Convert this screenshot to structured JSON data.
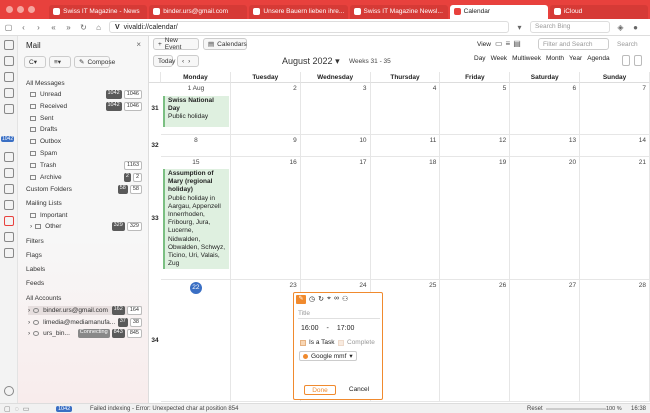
{
  "browser": {
    "tabs": [
      {
        "label": "Swiss IT Magazine - News"
      },
      {
        "label": "binder.urs@gmail.com"
      },
      {
        "label": "Unsere Bauern lieben ihre..."
      },
      {
        "label": "Swiss IT Magazine Newsl..."
      },
      {
        "label": "Calendar"
      },
      {
        "label": "iCloud"
      }
    ],
    "url": "vivaldi://calendar/",
    "search_placeholder": "Search Bing"
  },
  "mail": {
    "title": "Mail",
    "refresh": "C",
    "compose": "Compose",
    "all_messages": "All Messages",
    "folders": [
      {
        "label": "Unread",
        "c1": "1042",
        "c2": "1046"
      },
      {
        "label": "Received",
        "c1": "1042",
        "c2": "1046"
      },
      {
        "label": "Sent",
        "c1": "",
        "c2": ""
      },
      {
        "label": "Drafts",
        "c1": "",
        "c2": ""
      },
      {
        "label": "Outbox",
        "c1": "",
        "c2": ""
      },
      {
        "label": "Spam",
        "c1": "",
        "c2": ""
      },
      {
        "label": "Trash",
        "c1": "",
        "c2": "1163"
      },
      {
        "label": "Archive",
        "c1": "2",
        "c2": "2"
      }
    ],
    "custom_folders": "Custom Folders",
    "custom_counts": [
      "58",
      "58"
    ],
    "mailing_lists": "Mailing Lists",
    "important": "Important",
    "other": "Other",
    "other_counts": [
      "329",
      "329"
    ],
    "filters": "Filters",
    "flags": "Flags",
    "labels": "Labels",
    "feeds": "Feeds",
    "all_accounts": "All Accounts",
    "accounts": [
      {
        "label": "binder.urs@gmail.com",
        "c1": "162",
        "c2": "164"
      },
      {
        "label": "limedia@mediamanufa...",
        "c1": "37",
        "c2": "38"
      },
      {
        "label": "urs_bin...",
        "c1": "Connecting",
        "c2": "843",
        "c3": "845"
      }
    ],
    "badge": "1042"
  },
  "calendar": {
    "new_event": "New Event",
    "calendars": "Calendars",
    "view_label": "View",
    "filter_placeholder": "Filter and Search",
    "search_btn": "Search",
    "today": "Today",
    "month_title": "August 2022",
    "weeks": "Weeks 31 - 35",
    "views": [
      "Day",
      "Week",
      "Multiweek",
      "Month",
      "Year",
      "Agenda"
    ],
    "days": [
      "Monday",
      "Tuesday",
      "Wednesday",
      "Thursday",
      "Friday",
      "Saturday",
      "Sunday"
    ],
    "weeknums": [
      "31",
      "32",
      "33",
      "34"
    ],
    "rows": [
      [
        "1 Aug",
        "2",
        "3",
        "4",
        "5",
        "6",
        "7"
      ],
      [
        "8",
        "9",
        "10",
        "11",
        "12",
        "13",
        "14"
      ],
      [
        "15",
        "16",
        "17",
        "18",
        "19",
        "20",
        "21"
      ],
      [
        "22",
        "23",
        "24",
        "25",
        "26",
        "27",
        "28"
      ]
    ],
    "events": [
      {
        "title": "Swiss National Day",
        "sub": "Public holiday"
      },
      {
        "title": "Assumption of Mary (regional holiday)",
        "sub": "Public holiday in Aargau, Appenzell Innerrhoden, Fribourg, Jura, Lucerne, Nidwalden, Obwalden, Schwyz, Ticino, Uri, Valais, Zug"
      }
    ]
  },
  "popup": {
    "title_placeholder": "Title",
    "start": "16:00",
    "dash": "-",
    "end": "17:00",
    "is_task": "Is a Task",
    "complete": "Complete",
    "calendar": "Google mmf",
    "done": "Done",
    "cancel": "Cancel"
  },
  "status": {
    "message": "Failed indexing - Error: Unexpected char at position 854",
    "reset": "Reset",
    "zoom": "100 %",
    "time": "16:38"
  },
  "colors": {
    "accent": "#e8413d",
    "event": "#dff0e0",
    "popup_border": "#f08a2e",
    "today": "#3a6fc4"
  }
}
